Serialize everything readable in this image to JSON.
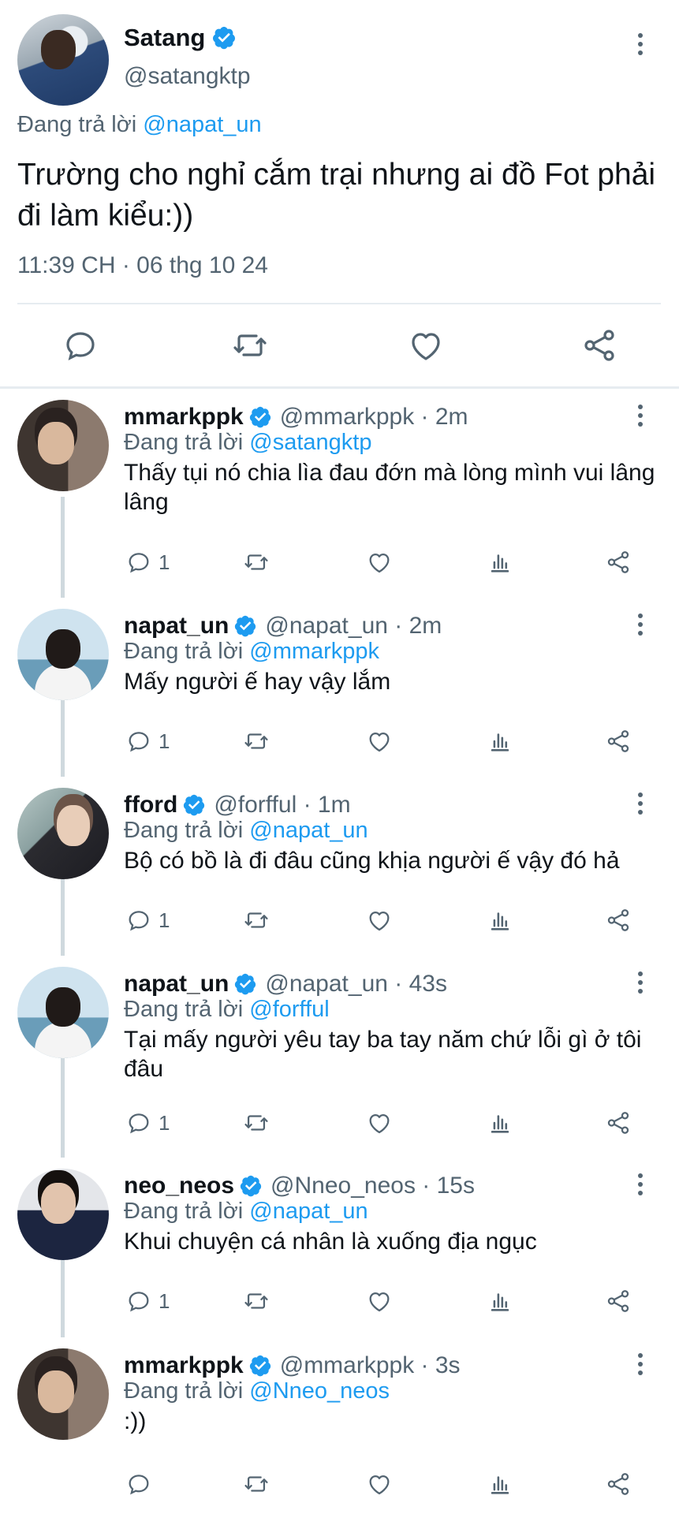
{
  "main_tweet": {
    "name": "Satang",
    "handle": "@satangktp",
    "reply_prefix": "Đang trả lời",
    "reply_to": "@napat_un",
    "text": "Trường cho nghỉ cắm trại nhưng ai đồ Fot phải đi làm kiểu:))",
    "timestamp": "11:39 CH · 06 thg 10 24"
  },
  "icons": {
    "verified": "verified-badge-icon",
    "reply": "reply-bubble-icon",
    "retweet": "retweet-icon",
    "like": "heart-icon",
    "analytics": "analytics-bars-icon",
    "share": "share-icon",
    "more": "more-vertical-icon"
  },
  "colors": {
    "link": "#1d9bf0",
    "secondary_text": "#536471",
    "primary_text": "#0f1419",
    "verified": "#1d9bf0"
  },
  "replies": [
    {
      "name": "mmarkppk",
      "handle": "@mmarkppk · 2m",
      "reply_prefix": "Đang trả lời",
      "reply_to": "@satangktp",
      "text": "Thấy tụi nó chia lìa đau đớn mà lòng mình vui lâng lâng",
      "reply_count": "1"
    },
    {
      "name": "napat_un",
      "handle": "@napat_un · 2m",
      "reply_prefix": "Đang trả lời",
      "reply_to": "@mmarkppk",
      "text": "Mấy người ế hay vậy lắm",
      "reply_count": "1"
    },
    {
      "name": "fford",
      "handle": "@forfful · 1m",
      "reply_prefix": "Đang trả lời",
      "reply_to": "@napat_un",
      "text": "Bộ có bồ là đi đâu cũng khịa người ế vậy đó hả",
      "reply_count": "1"
    },
    {
      "name": "napat_un",
      "handle": "@napat_un · 43s",
      "reply_prefix": "Đang trả lời",
      "reply_to": "@forfful",
      "text": "Tại mấy người yêu tay ba tay năm chứ lỗi gì ở tôi đâu",
      "reply_count": "1"
    },
    {
      "name": "neo_neos",
      "handle": "@Nneo_neos · 15s",
      "reply_prefix": "Đang trả lời",
      "reply_to": "@napat_un",
      "text": "Khui chuyện cá nhân là xuống địa ngục",
      "reply_count": "1"
    },
    {
      "name": "mmarkppk",
      "handle": "@mmarkppk · 3s",
      "reply_prefix": "Đang trả lời",
      "reply_to": "@Nneo_neos",
      "text": ":))",
      "reply_count": ""
    }
  ]
}
